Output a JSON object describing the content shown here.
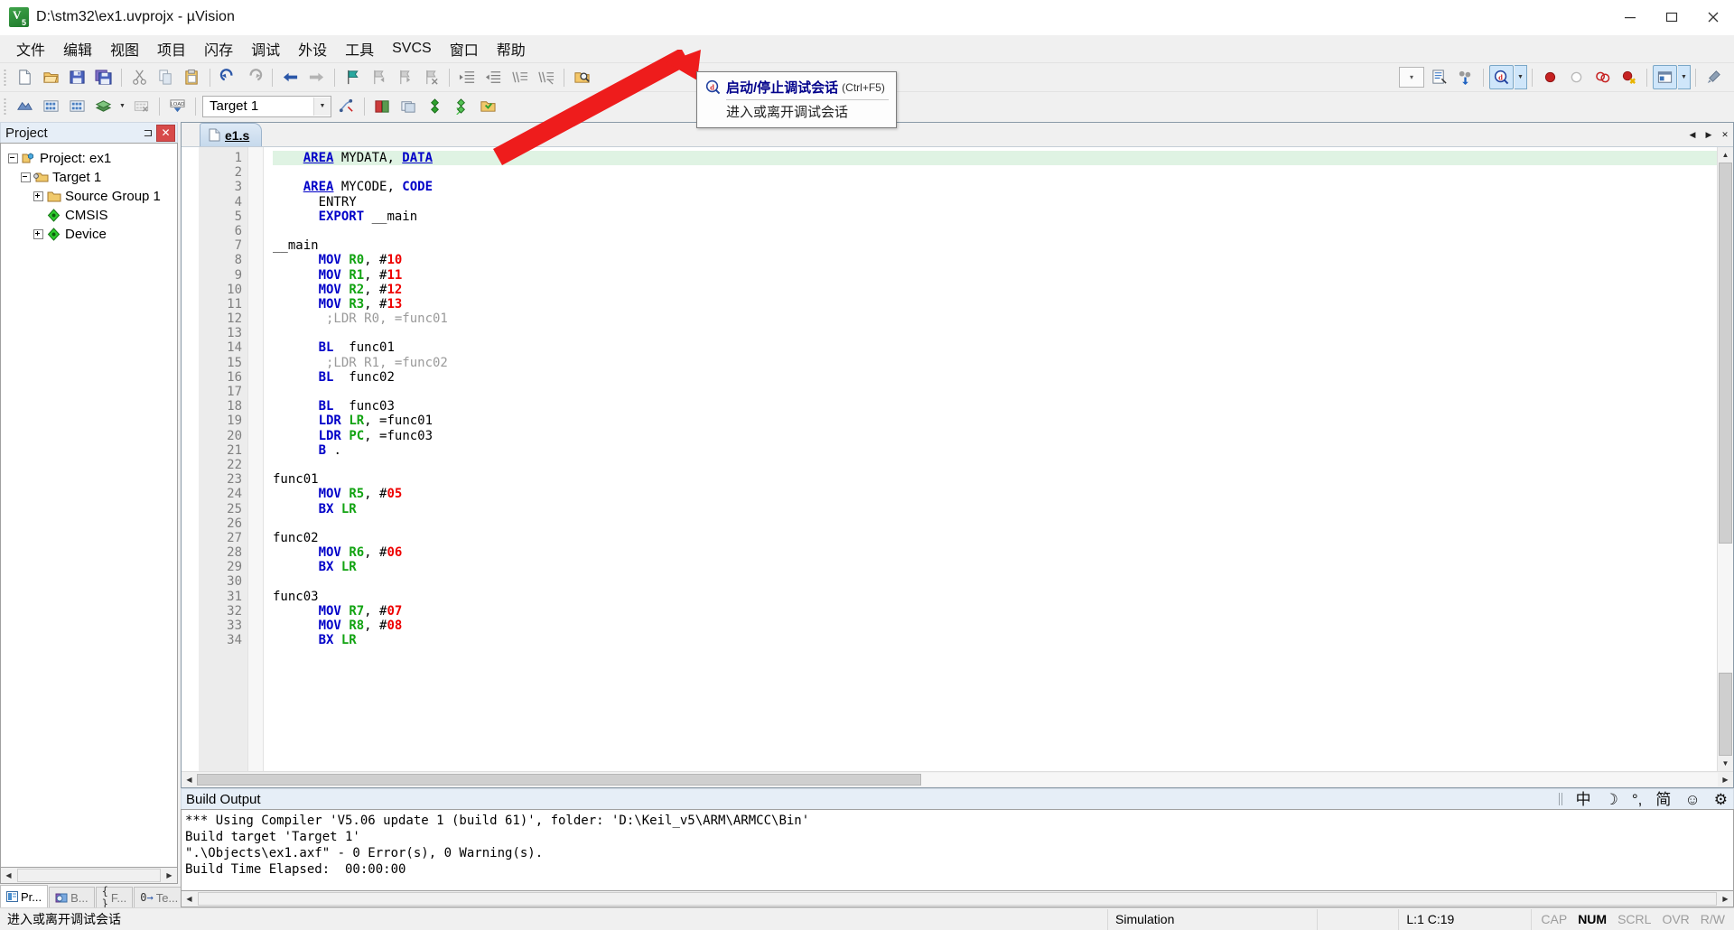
{
  "window": {
    "title": "D:\\stm32\\ex1.uvprojx - µVision",
    "icon": "uvision-logo-icon",
    "minimize": "minimize-button",
    "maximize": "maximize-button",
    "close": "close-button"
  },
  "menubar": {
    "items": [
      {
        "label": "文件",
        "name": "menu-file"
      },
      {
        "label": "编辑",
        "name": "menu-edit"
      },
      {
        "label": "视图",
        "name": "menu-view"
      },
      {
        "label": "项目",
        "name": "menu-project"
      },
      {
        "label": "闪存",
        "name": "menu-flash"
      },
      {
        "label": "调试",
        "name": "menu-debug"
      },
      {
        "label": "外设",
        "name": "menu-peripherals"
      },
      {
        "label": "工具",
        "name": "menu-tools"
      },
      {
        "label": "SVCS",
        "name": "menu-svcs"
      },
      {
        "label": "窗口",
        "name": "menu-window"
      },
      {
        "label": "帮助",
        "name": "menu-help"
      }
    ]
  },
  "toolbar_main": {
    "buttons": [
      "new-file-icon",
      "open-file-icon",
      "save-icon",
      "save-all-icon",
      "cut-icon",
      "copy-icon",
      "paste-icon",
      "undo-icon",
      "redo-icon",
      "navigate-back-icon",
      "navigate-forward-icon",
      "bookmark-toggle-icon",
      "bookmark-prev-icon",
      "bookmark-next-icon",
      "bookmark-clear-icon",
      "indent-icon",
      "outdent-icon",
      "comment-icon",
      "uncomment-icon",
      "find-in-files-icon"
    ],
    "right_buttons": [
      "search-combo",
      "insert-snippet-icon",
      "configure-icon"
    ],
    "debug_button": "start-stop-debug-session-icon",
    "debug_dropdown": "debug-options-dropdown",
    "breakpoint_buttons": [
      "insert-remove-breakpoint-icon",
      "enable-disable-breakpoint-icon",
      "disable-all-breakpoints-icon",
      "kill-all-breakpoints-icon"
    ],
    "window_button": "manage-window-layout-icon",
    "window_dropdown": "window-layout-dropdown",
    "settings_button": "configure-target-options-icon"
  },
  "toolbar_build": {
    "buttons": [
      "translate-file-icon",
      "build-target-icon",
      "rebuild-all-icon",
      "batch-build-icon",
      "batch-build-dropdown",
      "stop-build-icon",
      "download-to-flash-icon"
    ],
    "target_value": "Target 1",
    "target_dropdown": "target-select-dropdown",
    "after_buttons": [
      "target-options-icon",
      "manage-project-items-icon",
      "manage-run-time-env-icon",
      "select-software-packs-icon",
      "pack-installer-icon",
      "manage-components-icon"
    ]
  },
  "project_panel": {
    "title": "Project",
    "pin": "auto-hide-pin-icon",
    "close": "close-panel-button",
    "tree": [
      {
        "label": "Project: ex1",
        "icon": "project-icon",
        "indent": 0,
        "expander": "minus"
      },
      {
        "label": "Target 1",
        "icon": "target-folder-icon",
        "indent": 1,
        "expander": "minus"
      },
      {
        "label": "Source Group 1",
        "icon": "folder-icon",
        "indent": 2,
        "expander": "plus"
      },
      {
        "label": "CMSIS",
        "icon": "component-icon",
        "indent": 2,
        "expander": "none"
      },
      {
        "label": "Device",
        "icon": "component-icon",
        "indent": 2,
        "expander": "plus"
      }
    ],
    "tabs": [
      {
        "label": "Pr...",
        "icon": "project-tab-icon",
        "selected": true,
        "name": "tab-project"
      },
      {
        "label": "B...",
        "icon": "books-tab-icon",
        "selected": false,
        "name": "tab-books"
      },
      {
        "label": "F...",
        "icon": "functions-tab-icon",
        "selected": false,
        "name": "tab-functions"
      },
      {
        "label": "Te...",
        "icon": "templates-tab-icon",
        "selected": false,
        "name": "tab-templates"
      }
    ]
  },
  "editor": {
    "tab": {
      "label": "e1.s",
      "icon": "source-file-icon"
    },
    "tab_prev": "tab-scroll-left",
    "tab_next": "tab-scroll-right",
    "tab_close": "tab-close-button",
    "lines": [
      {
        "n": 1,
        "hl": true,
        "segs": [
          {
            "t": "    ",
            "c": "pl"
          },
          {
            "t": "AREA",
            "c": "dir"
          },
          {
            "t": " MYDATA, ",
            "c": "pl"
          },
          {
            "t": "DATA",
            "c": "dir"
          }
        ]
      },
      {
        "n": 2,
        "hl": false,
        "segs": []
      },
      {
        "n": 3,
        "hl": false,
        "segs": [
          {
            "t": "    ",
            "c": "pl"
          },
          {
            "t": "AREA",
            "c": "dir"
          },
          {
            "t": " MYCODE, ",
            "c": "pl"
          },
          {
            "t": "CODE",
            "c": "k"
          }
        ]
      },
      {
        "n": 4,
        "hl": false,
        "segs": [
          {
            "t": "      ",
            "c": "pl"
          },
          {
            "t": "ENTRY",
            "c": "pl"
          }
        ]
      },
      {
        "n": 5,
        "hl": false,
        "segs": [
          {
            "t": "      ",
            "c": "pl"
          },
          {
            "t": "EXPORT",
            "c": "k"
          },
          {
            "t": " __main",
            "c": "pl"
          }
        ]
      },
      {
        "n": 6,
        "hl": false,
        "segs": []
      },
      {
        "n": 7,
        "hl": false,
        "segs": [
          {
            "t": "__main",
            "c": "pl"
          }
        ]
      },
      {
        "n": 8,
        "hl": false,
        "segs": [
          {
            "t": "      ",
            "c": "pl"
          },
          {
            "t": "MOV",
            "c": "k"
          },
          {
            "t": " ",
            "c": "pl"
          },
          {
            "t": "R0",
            "c": "reg"
          },
          {
            "t": ", #",
            "c": "pl"
          },
          {
            "t": "10",
            "c": "num"
          }
        ]
      },
      {
        "n": 9,
        "hl": false,
        "segs": [
          {
            "t": "      ",
            "c": "pl"
          },
          {
            "t": "MOV",
            "c": "k"
          },
          {
            "t": " ",
            "c": "pl"
          },
          {
            "t": "R1",
            "c": "reg"
          },
          {
            "t": ", #",
            "c": "pl"
          },
          {
            "t": "11",
            "c": "num"
          }
        ]
      },
      {
        "n": 10,
        "hl": false,
        "segs": [
          {
            "t": "      ",
            "c": "pl"
          },
          {
            "t": "MOV",
            "c": "k"
          },
          {
            "t": " ",
            "c": "pl"
          },
          {
            "t": "R2",
            "c": "reg"
          },
          {
            "t": ", #",
            "c": "pl"
          },
          {
            "t": "12",
            "c": "num"
          }
        ]
      },
      {
        "n": 11,
        "hl": false,
        "segs": [
          {
            "t": "      ",
            "c": "pl"
          },
          {
            "t": "MOV",
            "c": "k"
          },
          {
            "t": " ",
            "c": "pl"
          },
          {
            "t": "R3",
            "c": "reg"
          },
          {
            "t": ", #",
            "c": "pl"
          },
          {
            "t": "13",
            "c": "num"
          }
        ]
      },
      {
        "n": 12,
        "hl": false,
        "segs": [
          {
            "t": "       ;LDR R0, =func01",
            "c": "cmt"
          }
        ]
      },
      {
        "n": 13,
        "hl": false,
        "segs": []
      },
      {
        "n": 14,
        "hl": false,
        "segs": [
          {
            "t": "      ",
            "c": "pl"
          },
          {
            "t": "BL",
            "c": "k"
          },
          {
            "t": "  func01",
            "c": "pl"
          }
        ]
      },
      {
        "n": 15,
        "hl": false,
        "segs": [
          {
            "t": "       ;LDR R1, =func02",
            "c": "cmt"
          }
        ]
      },
      {
        "n": 16,
        "hl": false,
        "segs": [
          {
            "t": "      ",
            "c": "pl"
          },
          {
            "t": "BL",
            "c": "k"
          },
          {
            "t": "  func02",
            "c": "pl"
          }
        ]
      },
      {
        "n": 17,
        "hl": false,
        "segs": []
      },
      {
        "n": 18,
        "hl": false,
        "segs": [
          {
            "t": "      ",
            "c": "pl"
          },
          {
            "t": "BL",
            "c": "k"
          },
          {
            "t": "  func03",
            "c": "pl"
          }
        ]
      },
      {
        "n": 19,
        "hl": false,
        "segs": [
          {
            "t": "      ",
            "c": "pl"
          },
          {
            "t": "LDR",
            "c": "k"
          },
          {
            "t": " ",
            "c": "pl"
          },
          {
            "t": "LR",
            "c": "reg"
          },
          {
            "t": ", =func01",
            "c": "pl"
          }
        ]
      },
      {
        "n": 20,
        "hl": false,
        "segs": [
          {
            "t": "      ",
            "c": "pl"
          },
          {
            "t": "LDR",
            "c": "k"
          },
          {
            "t": " ",
            "c": "pl"
          },
          {
            "t": "PC",
            "c": "reg"
          },
          {
            "t": ", =func03",
            "c": "pl"
          }
        ]
      },
      {
        "n": 21,
        "hl": false,
        "segs": [
          {
            "t": "      ",
            "c": "pl"
          },
          {
            "t": "B",
            "c": "k"
          },
          {
            "t": " .",
            "c": "pl"
          }
        ]
      },
      {
        "n": 22,
        "hl": false,
        "segs": []
      },
      {
        "n": 23,
        "hl": false,
        "segs": [
          {
            "t": "func01",
            "c": "pl"
          }
        ]
      },
      {
        "n": 24,
        "hl": false,
        "segs": [
          {
            "t": "      ",
            "c": "pl"
          },
          {
            "t": "MOV",
            "c": "k"
          },
          {
            "t": " ",
            "c": "pl"
          },
          {
            "t": "R5",
            "c": "reg"
          },
          {
            "t": ", #",
            "c": "pl"
          },
          {
            "t": "05",
            "c": "num"
          }
        ]
      },
      {
        "n": 25,
        "hl": false,
        "segs": [
          {
            "t": "      ",
            "c": "pl"
          },
          {
            "t": "BX",
            "c": "k"
          },
          {
            "t": " ",
            "c": "pl"
          },
          {
            "t": "LR",
            "c": "reg"
          }
        ]
      },
      {
        "n": 26,
        "hl": false,
        "segs": []
      },
      {
        "n": 27,
        "hl": false,
        "segs": [
          {
            "t": "func02",
            "c": "pl"
          }
        ]
      },
      {
        "n": 28,
        "hl": false,
        "segs": [
          {
            "t": "      ",
            "c": "pl"
          },
          {
            "t": "MOV",
            "c": "k"
          },
          {
            "t": " ",
            "c": "pl"
          },
          {
            "t": "R6",
            "c": "reg"
          },
          {
            "t": ", #",
            "c": "pl"
          },
          {
            "t": "06",
            "c": "num"
          }
        ]
      },
      {
        "n": 29,
        "hl": false,
        "segs": [
          {
            "t": "      ",
            "c": "pl"
          },
          {
            "t": "BX",
            "c": "k"
          },
          {
            "t": " ",
            "c": "pl"
          },
          {
            "t": "LR",
            "c": "reg"
          }
        ]
      },
      {
        "n": 30,
        "hl": false,
        "segs": []
      },
      {
        "n": 31,
        "hl": false,
        "segs": [
          {
            "t": "func03",
            "c": "pl"
          }
        ]
      },
      {
        "n": 32,
        "hl": false,
        "segs": [
          {
            "t": "      ",
            "c": "pl"
          },
          {
            "t": "MOV",
            "c": "k"
          },
          {
            "t": " ",
            "c": "pl"
          },
          {
            "t": "R7",
            "c": "reg"
          },
          {
            "t": ", #",
            "c": "pl"
          },
          {
            "t": "07",
            "c": "num"
          }
        ]
      },
      {
        "n": 33,
        "hl": false,
        "segs": [
          {
            "t": "      ",
            "c": "pl"
          },
          {
            "t": "MOV",
            "c": "k"
          },
          {
            "t": " ",
            "c": "pl"
          },
          {
            "t": "R8",
            "c": "reg"
          },
          {
            "t": ", #",
            "c": "pl"
          },
          {
            "t": "08",
            "c": "num"
          }
        ]
      },
      {
        "n": 34,
        "hl": false,
        "segs": [
          {
            "t": "      ",
            "c": "pl"
          },
          {
            "t": "BX",
            "c": "k"
          },
          {
            "t": " ",
            "c": "pl"
          },
          {
            "t": "LR",
            "c": "reg"
          }
        ]
      }
    ]
  },
  "build_output": {
    "title": "Build Output",
    "lines": [
      "*** Using Compiler 'V5.06 update 1 (build 61)', folder: 'D:\\Keil_v5\\ARM\\ARMCC\\Bin'",
      "Build target 'Target 1'",
      "\".\\Objects\\ex1.axf\" - 0 Error(s), 0 Warning(s).",
      "Build Time Elapsed:  00:00:00"
    ]
  },
  "ime_bar": {
    "items": [
      {
        "glyph": "中",
        "name": "ime-chinese-mode-button"
      },
      {
        "glyph": "☽",
        "name": "ime-half-width-button"
      },
      {
        "glyph": "°,",
        "name": "ime-punctuation-button"
      },
      {
        "glyph": "简",
        "name": "ime-simplified-button"
      },
      {
        "glyph": "☺",
        "name": "ime-emoji-button"
      },
      {
        "glyph": "⚙",
        "name": "ime-settings-button"
      }
    ]
  },
  "tooltip": {
    "icon": "start-stop-debug-session-icon",
    "title": "启动/停止调试会话",
    "shortcut": "(Ctrl+F5)",
    "subtitle": "进入或离开调试会话"
  },
  "status_bar": {
    "message": "进入或离开调试会话",
    "simulation": "Simulation",
    "cursor": "L:1 C:19",
    "indicators": [
      {
        "label": "CAP",
        "on": false
      },
      {
        "label": "NUM",
        "on": true
      },
      {
        "label": "SCRL",
        "on": false
      },
      {
        "label": "OVR",
        "on": false
      },
      {
        "label": "R/W",
        "on": false
      }
    ]
  },
  "colors": {
    "accent": "#0000c8",
    "register": "#12a312",
    "number": "#ee0000",
    "comment": "#9a9a9a",
    "highlight_line": "#dff3e3",
    "callout_arrow": "#ee1c1c",
    "panel_header": "#e6eef7"
  }
}
